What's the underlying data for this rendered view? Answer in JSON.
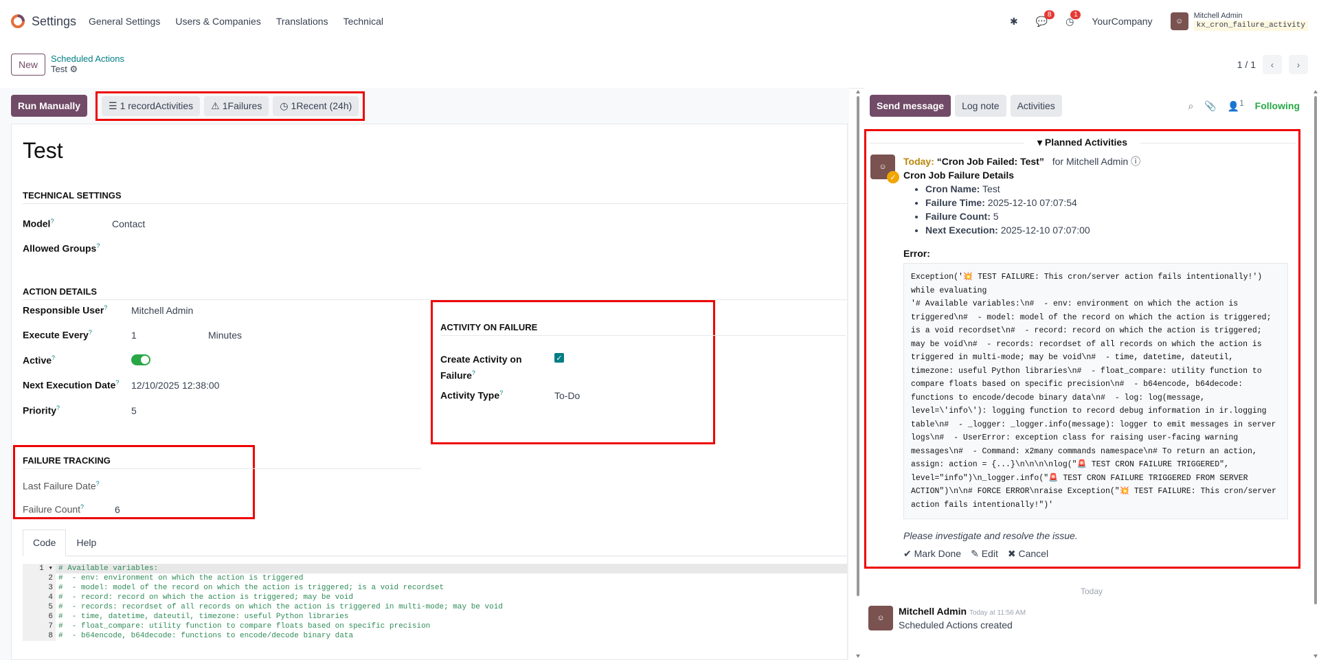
{
  "topnav": {
    "app": "Settings",
    "menu": [
      "General Settings",
      "Users & Companies",
      "Translations",
      "Technical"
    ],
    "chat_count": "8",
    "activity_count": "1",
    "company": "YourCompany",
    "user": "Mitchell Admin",
    "db": "kx_cron_failure_activity"
  },
  "breadcrumb": {
    "new": "New",
    "parent": "Scheduled Actions",
    "current": "Test",
    "pager": "1 / 1"
  },
  "statusbar": {
    "run": "Run Manually",
    "record": "1 recordActivities",
    "failures": "1Failures",
    "recent": "1Recent (24h)"
  },
  "form": {
    "title": "Test",
    "tech_section": "TECHNICAL SETTINGS",
    "model_label": "Model",
    "model_value": "Contact",
    "groups_label": "Allowed Groups",
    "action_section": "ACTION DETAILS",
    "resp_label": "Responsible User",
    "resp_value": "Mitchell Admin",
    "every_label": "Execute Every",
    "every_value": "1",
    "every_unit": "Minutes",
    "active_label": "Active",
    "next_label": "Next Execution Date",
    "next_value": "12/10/2025 12:38:00",
    "priority_label": "Priority",
    "priority_value": "5",
    "activity_section": "ACTIVITY ON FAILURE",
    "create_label": "Create Activity on Failure",
    "type_label": "Activity Type",
    "type_value": "To-Do",
    "failure_section": "FAILURE TRACKING",
    "lastfail_label": "Last Failure Date",
    "count_label": "Failure Count",
    "count_value": "6",
    "tabs": [
      "Code",
      "Help"
    ],
    "code_lines": [
      "# Available variables:",
      "#  - env: environment on which the action is triggered",
      "#  - model: model of the record on which the action is triggered; is a void recordset",
      "#  - record: record on which the action is triggered; may be void",
      "#  - records: recordset of all records on which the action is triggered in multi-mode; may be void",
      "#  - time, datetime, dateutil, timezone: useful Python libraries",
      "#  - float_compare: utility function to compare floats based on specific precision",
      "#  - b64encode, b64decode: functions to encode/decode binary data"
    ]
  },
  "chatter": {
    "send": "Send message",
    "log": "Log note",
    "activities": "Activities",
    "follower_count": "1",
    "following": "Following",
    "planned": "Planned Activities",
    "today": "Today:",
    "act_title": "“Cron Job Failed: Test”",
    "for_user": "for Mitchell Admin",
    "details_title": "Cron Job Failure Details",
    "details": [
      {
        "k": "Cron Name:",
        "v": "Test"
      },
      {
        "k": "Failure Time:",
        "v": "2025-12-10 07:07:54"
      },
      {
        "k": "Failure Count:",
        "v": "5"
      },
      {
        "k": "Next Execution:",
        "v": "2025-12-10 07:07:00"
      }
    ],
    "error_label": "Error:",
    "error_text": "Exception('💥 TEST FAILURE: This cron/server action fails intentionally!') while evaluating\n'# Available variables:\\n#  - env: environment on which the action is triggered\\n#  - model: model of the record on which the action is triggered; is a void recordset\\n#  - record: record on which the action is triggered; may be void\\n#  - records: recordset of all records on which the action is triggered in multi-mode; may be void\\n#  - time, datetime, dateutil, timezone: useful Python libraries\\n#  - float_compare: utility function to compare floats based on specific precision\\n#  - b64encode, b64decode: functions to encode/decode binary data\\n#  - log: log(message, level=\\'info\\'): logging function to record debug information in ir.logging table\\n#  - _logger: _logger.info(message): logger to emit messages in server logs\\n#  - UserError: exception class for raising user-facing warning messages\\n#  - Command: x2many commands namespace\\n# To return an action, assign: action = {...}\\n\\n\\n\\nlog(\"🚨 TEST CRON FAILURE TRIGGERED\", level=\"info\")\\n_logger.info(\"🚨 TEST CRON FAILURE TRIGGERED FROM SERVER ACTION\")\\n\\n# FORCE ERROR\\nraise Exception(\"💥 TEST FAILURE: This cron/server action fails intentionally!\")'",
    "investigate": "Please investigate and resolve the issue.",
    "mark_done": "Mark Done",
    "edit": "Edit",
    "cancel": "Cancel",
    "sep": "Today",
    "msg_author": "Mitchell Admin",
    "msg_time": "Today at 11:56 AM",
    "msg_body": "Scheduled Actions created"
  }
}
